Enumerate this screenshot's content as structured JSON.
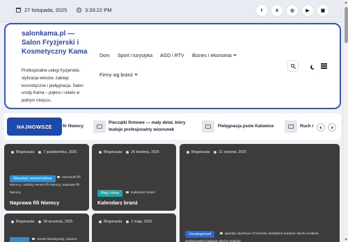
{
  "topbar": {
    "date": "27 listopada, 2025",
    "time": "3:33:22 PM",
    "social": [
      "f",
      "X",
      "◎",
      "▶"
    ]
  },
  "header": {
    "title": "salonkama.pl — Salon Fryzjerski i Kosmetyczny Kama",
    "description": "Profesjonalne usługi fryzjerskie, stylizacja włosów, zabiegi kosmetyczne i pielęgnacja. Salon urody Kama – piękno i relaks w jednym miejscu."
  },
  "nav": {
    "items": [
      "Dom",
      "Sport i turystyka",
      "AGD i RTV",
      "Biznes i ekonomia",
      "Firmy wg branż"
    ]
  },
  "ticker": {
    "label": "NAJNOWSZE",
    "items": [
      "fir Niemcy",
      "Pieczątki firmowe — mały detal, który buduje profesjonalny wizerunek",
      "Pielęgnacja psów Katowice",
      "Ruch r"
    ]
  },
  "cards": [
    {
      "author": "Blogonauta",
      "date": "7 października, 2025",
      "category": "Warsztaty samochodowe",
      "tags": "mechanik fifi Niemcy, mobilny serwis fifi Niemcy, naprawa fifi Niemcy",
      "title": "Naprawa fifi Niemcy"
    },
    {
      "author": "Blogonauta",
      "date": "26 kwietnia, 2025",
      "category": "Płaty i firma",
      "tags": "Kalendarz branż",
      "title": "Kalendarz branż"
    },
    {
      "author": "Blogonauta",
      "date": "21 sierpnia, 2025",
      "category": "Uncategorized",
      "tags": "aparaty słuchowe Chrzanów, bezpłatne badanie słuchu Kraków, profesjonalne badanie słuchu Kraków"
    },
    {
      "author": "Blogonauta",
      "date": "28 września, 2025",
      "tags": "serwis klimatyzacji, pisarzo"
    },
    {
      "author": "Blogonauta",
      "date": "2 maja, 2025"
    }
  ]
}
